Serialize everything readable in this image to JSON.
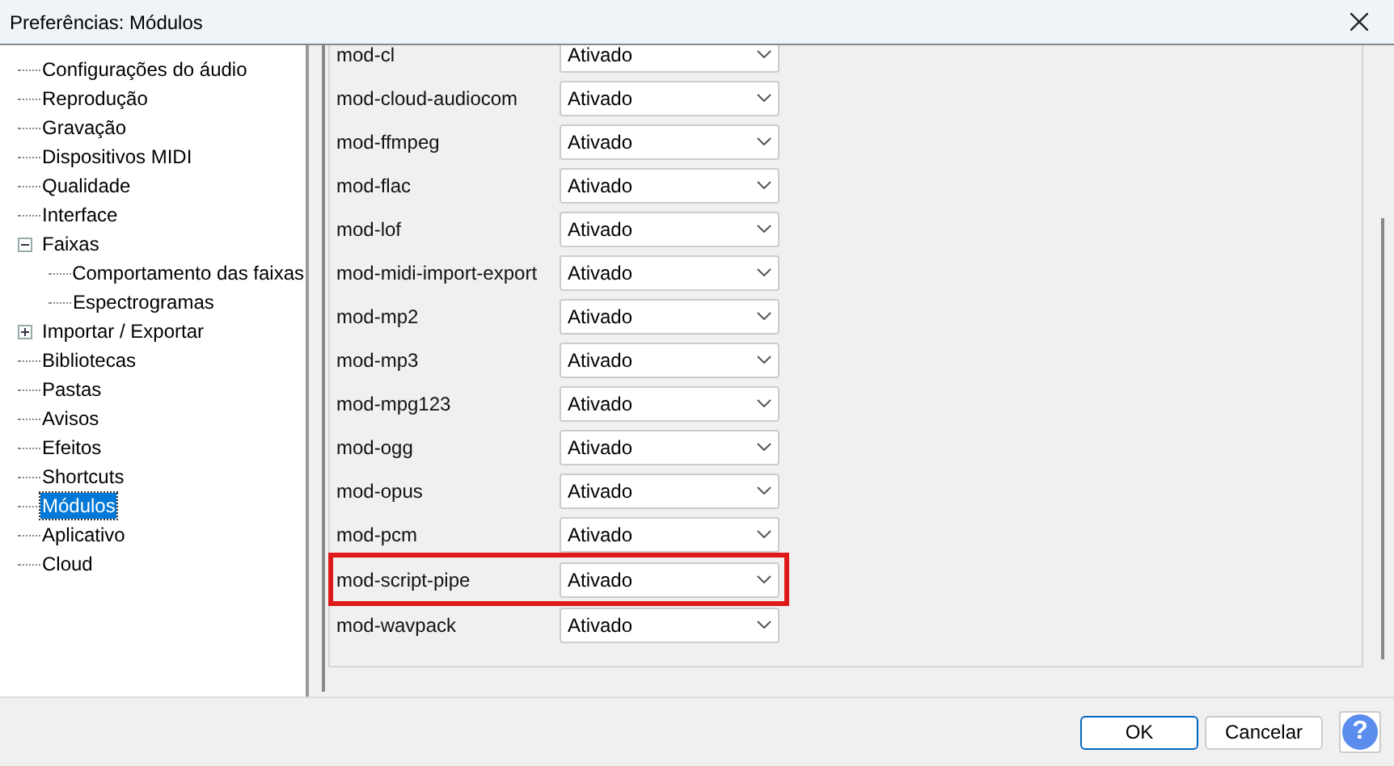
{
  "window": {
    "title": "Preferências: Módulos"
  },
  "tree": [
    {
      "label": "Configurações do áudio",
      "selected": false
    },
    {
      "label": "Reprodução",
      "selected": false
    },
    {
      "label": "Gravação",
      "selected": false
    },
    {
      "label": "Dispositivos MIDI",
      "selected": false
    },
    {
      "label": "Qualidade",
      "selected": false
    },
    {
      "label": "Interface",
      "selected": false
    },
    {
      "label": "Faixas",
      "selected": false,
      "expanded": true,
      "children": [
        {
          "label": "Comportamento das faixas",
          "selected": false
        },
        {
          "label": "Espectrogramas",
          "selected": false
        }
      ]
    },
    {
      "label": "Importar / Exportar",
      "selected": false,
      "expanded": false
    },
    {
      "label": "Bibliotecas",
      "selected": false
    },
    {
      "label": "Pastas",
      "selected": false
    },
    {
      "label": "Avisos",
      "selected": false
    },
    {
      "label": "Efeitos",
      "selected": false
    },
    {
      "label": "Shortcuts",
      "selected": false
    },
    {
      "label": "Módulos",
      "selected": true
    },
    {
      "label": "Aplicativo",
      "selected": false
    },
    {
      "label": "Cloud",
      "selected": false
    }
  ],
  "modules": [
    {
      "name": "mod-cl",
      "value": "Ativado",
      "highlighted": false
    },
    {
      "name": "mod-cloud-audiocom",
      "value": "Ativado",
      "highlighted": false
    },
    {
      "name": "mod-ffmpeg",
      "value": "Ativado",
      "highlighted": false
    },
    {
      "name": "mod-flac",
      "value": "Ativado",
      "highlighted": false
    },
    {
      "name": "mod-lof",
      "value": "Ativado",
      "highlighted": false
    },
    {
      "name": "mod-midi-import-export",
      "value": "Ativado",
      "highlighted": false
    },
    {
      "name": "mod-mp2",
      "value": "Ativado",
      "highlighted": false
    },
    {
      "name": "mod-mp3",
      "value": "Ativado",
      "highlighted": false
    },
    {
      "name": "mod-mpg123",
      "value": "Ativado",
      "highlighted": false
    },
    {
      "name": "mod-ogg",
      "value": "Ativado",
      "highlighted": false
    },
    {
      "name": "mod-opus",
      "value": "Ativado",
      "highlighted": false
    },
    {
      "name": "mod-pcm",
      "value": "Ativado",
      "highlighted": false
    },
    {
      "name": "mod-script-pipe",
      "value": "Ativado",
      "highlighted": true
    },
    {
      "name": "mod-wavpack",
      "value": "Ativado",
      "highlighted": false
    }
  ],
  "buttons": [
    {
      "label": "OK",
      "kind": "default"
    },
    {
      "label": "Cancelar",
      "kind": "normal"
    },
    {
      "label": "?",
      "kind": "help"
    }
  ]
}
